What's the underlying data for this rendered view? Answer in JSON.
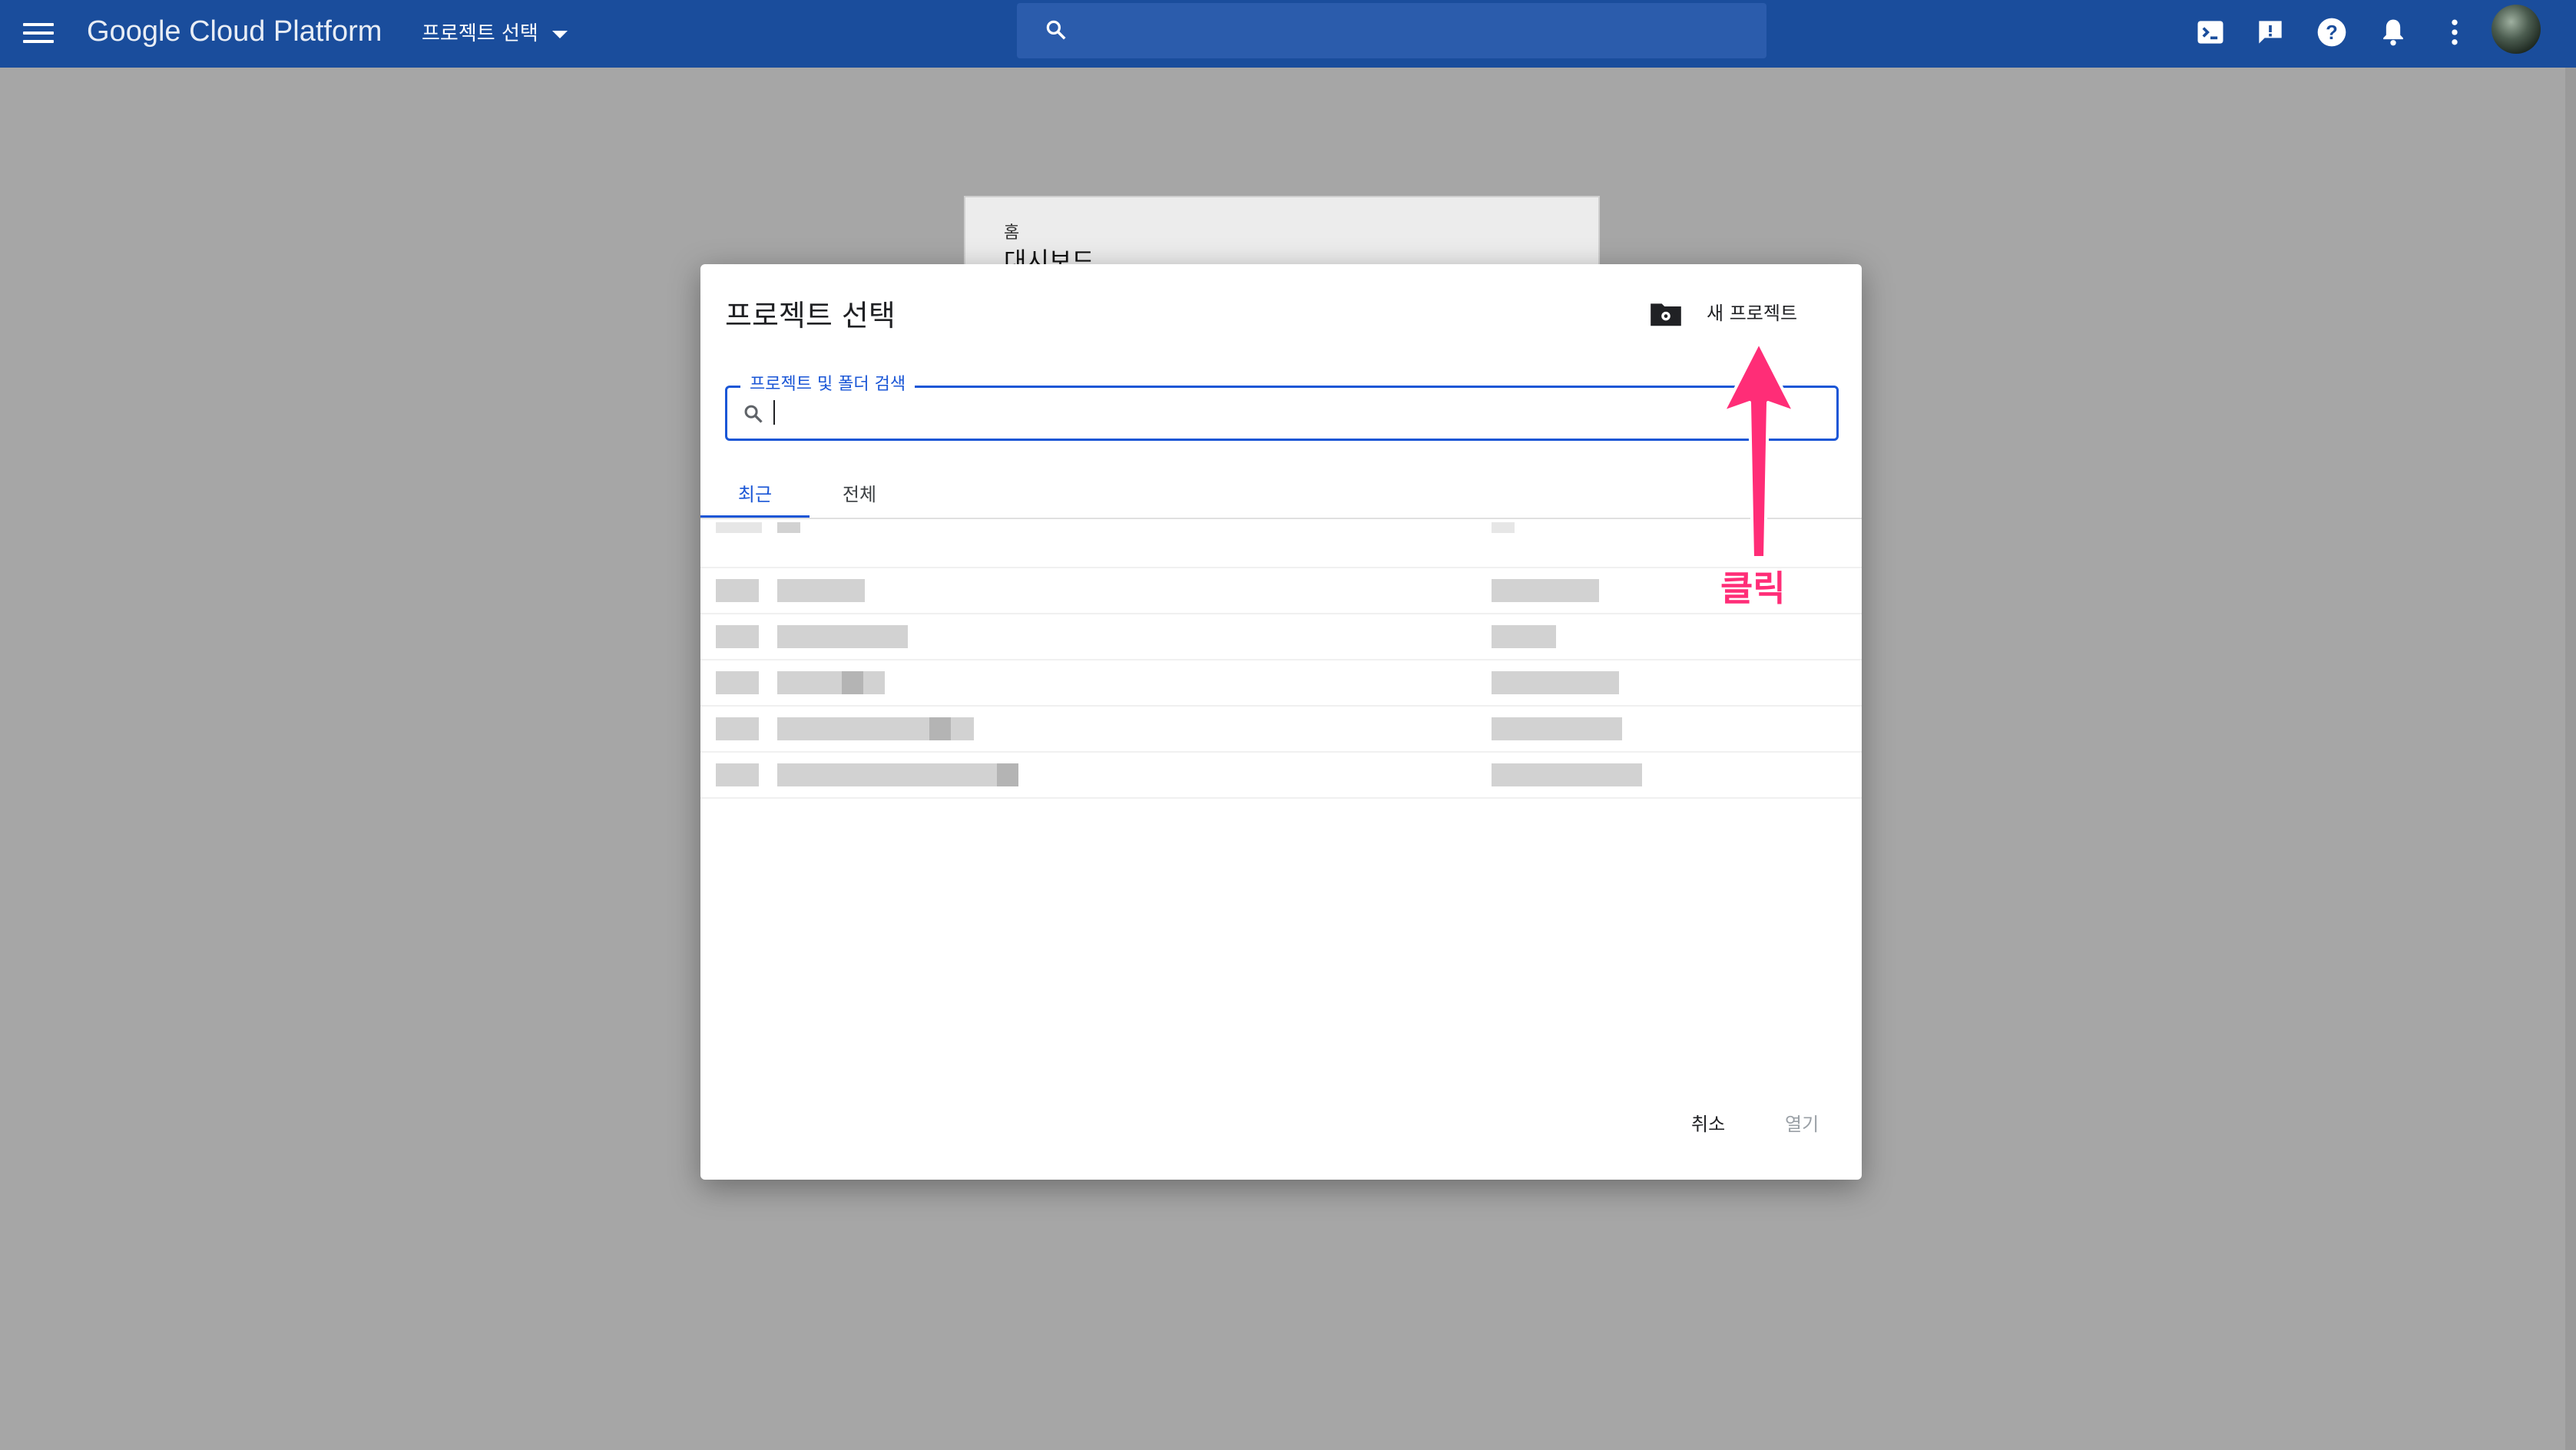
{
  "topbar": {
    "brand": "Google Cloud Platform",
    "project_selector": "프로젝트 선택",
    "icons": [
      "menu-icon",
      "search-icon",
      "cloud-shell-icon",
      "feedback-icon",
      "help-icon",
      "notifications-icon",
      "more-vert-icon",
      "account-avatar"
    ]
  },
  "background_card": {
    "breadcrumb": "홈",
    "title": "대시보드"
  },
  "dialog": {
    "title": "프로젝트 선택",
    "new_project_label": "새 프로젝트",
    "search": {
      "label": "프로젝트 및 폴더 검색",
      "value": ""
    },
    "tabs": [
      {
        "label": "최근",
        "active": true
      },
      {
        "label": "전체",
        "active": false
      }
    ],
    "cancel_label": "취소",
    "open_label": "열기"
  },
  "annotation": {
    "text": "클릭",
    "color": "#ff2d77"
  },
  "colors": {
    "topbar": "#1a4d9c",
    "accent": "#1a56d6",
    "overlay": "#a6a6a6"
  }
}
